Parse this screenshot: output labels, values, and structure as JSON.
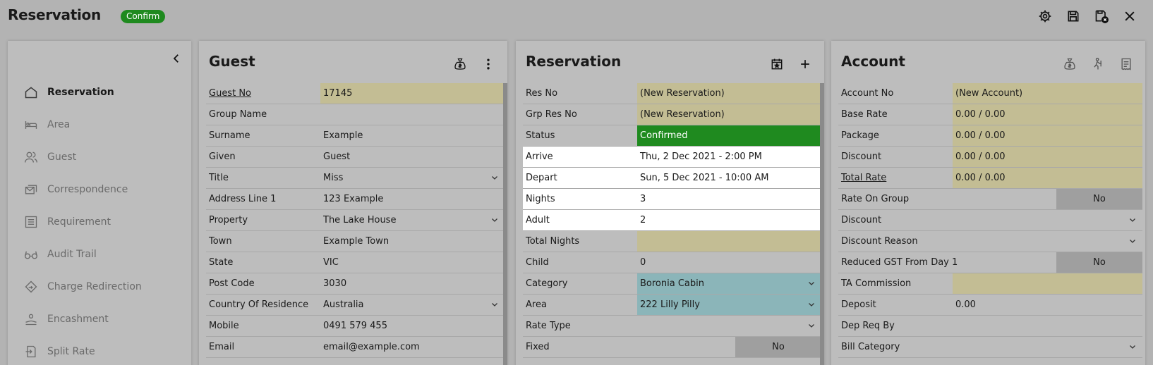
{
  "app": {
    "title": "Reservation",
    "status_badge": "Confirm"
  },
  "top_icons": [
    "gear-icon",
    "save-icon",
    "save-close-icon",
    "close-icon"
  ],
  "sidebar": {
    "items": [
      {
        "label": "Reservation",
        "icon": "home-icon",
        "active": true
      },
      {
        "label": "Area",
        "icon": "bed-icon"
      },
      {
        "label": "Guest",
        "icon": "people-icon"
      },
      {
        "label": "Correspondence",
        "icon": "mail-icon"
      },
      {
        "label": "Requirement",
        "icon": "list-icon"
      },
      {
        "label": "Audit Trail",
        "icon": "glasses-icon"
      },
      {
        "label": "Charge Redirection",
        "icon": "redirect-icon"
      },
      {
        "label": "Encashment",
        "icon": "cash-icon"
      },
      {
        "label": "Split Rate",
        "icon": "split-icon"
      }
    ]
  },
  "guest": {
    "title": "Guest",
    "rows": [
      {
        "label": "Guest No",
        "value": "17145"
      },
      {
        "label": "Group Name",
        "value": ""
      },
      {
        "label": "Surname",
        "value": "Example"
      },
      {
        "label": "Given",
        "value": "Guest"
      },
      {
        "label": "Title",
        "value": "Miss"
      },
      {
        "label": "Address Line 1",
        "value": "123 Example"
      },
      {
        "label": "Property",
        "value": "The Lake House"
      },
      {
        "label": "Town",
        "value": "Example Town"
      },
      {
        "label": "State",
        "value": "VIC"
      },
      {
        "label": "Post Code",
        "value": "3030"
      },
      {
        "label": "Country Of Residence",
        "value": "Australia"
      },
      {
        "label": "Mobile",
        "value": "0491 579 455"
      },
      {
        "label": "Email",
        "value": "email@example.com"
      }
    ]
  },
  "reservation": {
    "title": "Reservation",
    "rows": [
      {
        "label": "Res No",
        "value": "(New Reservation)"
      },
      {
        "label": "Grp Res No",
        "value": "(New Reservation)"
      },
      {
        "label": "Status",
        "value": "Confirmed"
      },
      {
        "label": "Arrive",
        "value": "Thu, 2 Dec 2021 - 2:00 PM"
      },
      {
        "label": "Depart",
        "value": "Sun, 5 Dec 2021 - 10:00 AM"
      },
      {
        "label": "Nights",
        "value": "3"
      },
      {
        "label": "Adult",
        "value": "2"
      },
      {
        "label": "Total Nights",
        "value": ""
      },
      {
        "label": "Child",
        "value": "0"
      },
      {
        "label": "Category",
        "value": "Boronia Cabin"
      },
      {
        "label": "Area",
        "value": "222 Lilly Pilly"
      },
      {
        "label": "Rate Type",
        "value": ""
      },
      {
        "label": "Fixed",
        "value": "No"
      }
    ]
  },
  "account": {
    "title": "Account",
    "rows": [
      {
        "label": "Account No",
        "value": "(New Account)"
      },
      {
        "label": "Base Rate",
        "value": "0.00 / 0.00"
      },
      {
        "label": "Package",
        "value": "0.00 / 0.00"
      },
      {
        "label": "Discount",
        "value": "0.00 / 0.00"
      },
      {
        "label": "Total Rate",
        "value": "0.00 / 0.00"
      },
      {
        "label": "Rate On Group",
        "value": "No"
      },
      {
        "label": "Discount",
        "value": ""
      },
      {
        "label": "Discount Reason",
        "value": ""
      },
      {
        "label": "Reduced GST From Day 1",
        "value": "No"
      },
      {
        "label": "TA Commission",
        "value": ""
      },
      {
        "label": "Deposit",
        "value": "0.00"
      },
      {
        "label": "Dep Req By",
        "value": ""
      },
      {
        "label": "Bill Category",
        "value": ""
      }
    ]
  },
  "colors": {
    "confirm_green": "#1f8a1f",
    "readonly_tan": "#c3bd94",
    "lookup_teal": "#8bb5b9",
    "panel_bg": "#bdbdbd"
  }
}
